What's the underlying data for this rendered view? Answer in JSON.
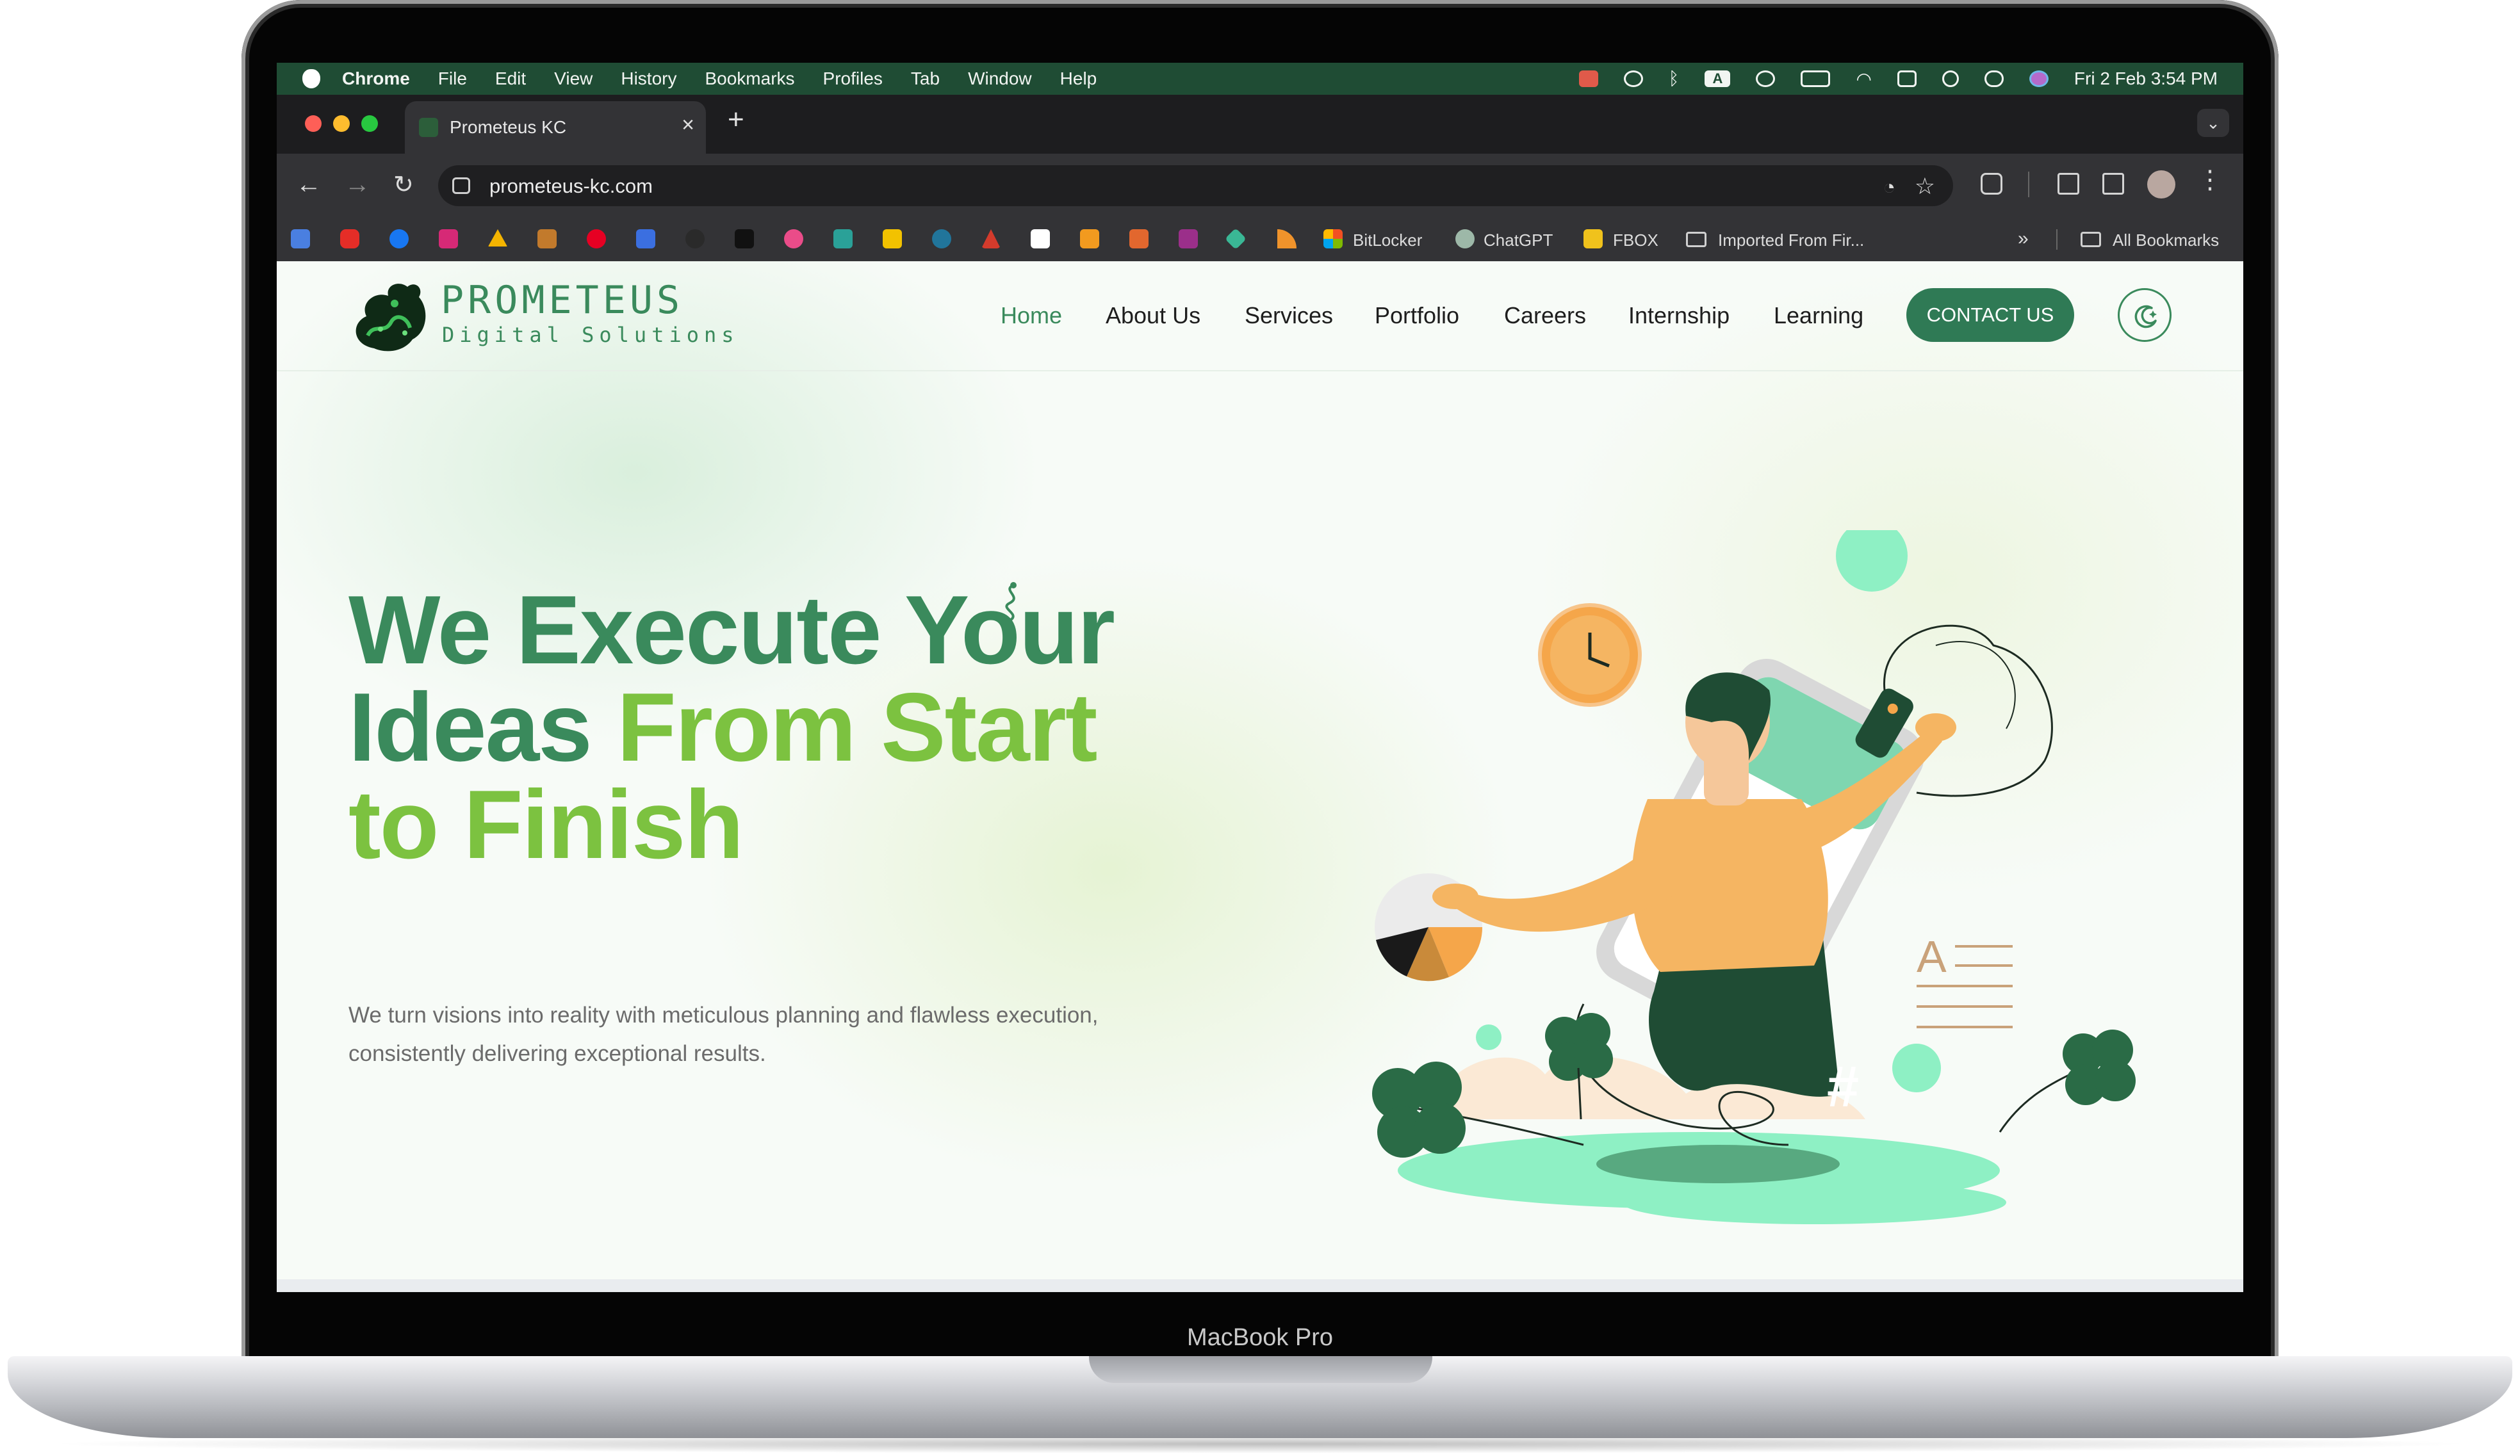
{
  "device": {
    "label": "MacBook Pro"
  },
  "menubar": {
    "app_name": "Chrome",
    "items": [
      "File",
      "Edit",
      "View",
      "History",
      "Bookmarks",
      "Profiles",
      "Tab",
      "Window",
      "Help"
    ],
    "status_icons": [
      "record-icon",
      "play-icon",
      "bluetooth-icon",
      "keyboard-input-icon",
      "airpods-icon",
      "battery-icon",
      "wifi-icon",
      "screen-mirror-icon",
      "spotlight-icon",
      "control-center-icon",
      "siri-icon"
    ],
    "keyboard_input": "A",
    "clock": "Fri 2 Feb  3:54 PM"
  },
  "browser": {
    "tab_title": "Prometeus KC",
    "url": "prometeus-kc.com",
    "bookmarks": [
      {
        "label": "BitLocker",
        "icon": "windows-icon"
      },
      {
        "label": "ChatGPT",
        "icon": "chatgpt-icon"
      },
      {
        "label": "FBOX",
        "icon": "fbox-icon"
      },
      {
        "label": "Imported From Fir...",
        "icon": "folder-icon"
      }
    ],
    "bookmark_icons": [
      "translate-icon",
      "youtube-icon",
      "facebook-icon",
      "instagram-icon",
      "drive-icon",
      "bookmark-icon",
      "pinterest-icon",
      "forms-icon",
      "github-icon",
      "blocks-icon",
      "dribbble-icon",
      "docs-icon",
      "bee-icon",
      "wordpress-icon",
      "adobe-icon",
      "cc-icon",
      "square-icon",
      "gitlab-icon",
      "canvas-icon",
      "sketch-icon",
      "rss-icon"
    ],
    "all_bookmarks": "All Bookmarks",
    "overflow": "»"
  },
  "site": {
    "brand": {
      "name": "PROMETEUS",
      "tagline": "Digital Solutions"
    },
    "nav": [
      {
        "label": "Home",
        "active": true
      },
      {
        "label": "About Us"
      },
      {
        "label": "Services"
      },
      {
        "label": "Portfolio"
      },
      {
        "label": "Careers"
      },
      {
        "label": "Internship"
      },
      {
        "label": "Learning"
      }
    ],
    "contact_button": "CONTACT US",
    "hero": {
      "line1": "We Execute Your",
      "line2_a": "Ideas ",
      "line2_b": "From Start",
      "line3": "to Finish",
      "subtitle": "We turn visions into reality with meticulous planning and flawless execution, consistently delivering exceptional results."
    },
    "colors": {
      "primary": "#3a8a5c",
      "accent": "#7cc240",
      "button": "#2f7a55",
      "mint": "#8ef0c4",
      "orange": "#f5a64a"
    }
  }
}
